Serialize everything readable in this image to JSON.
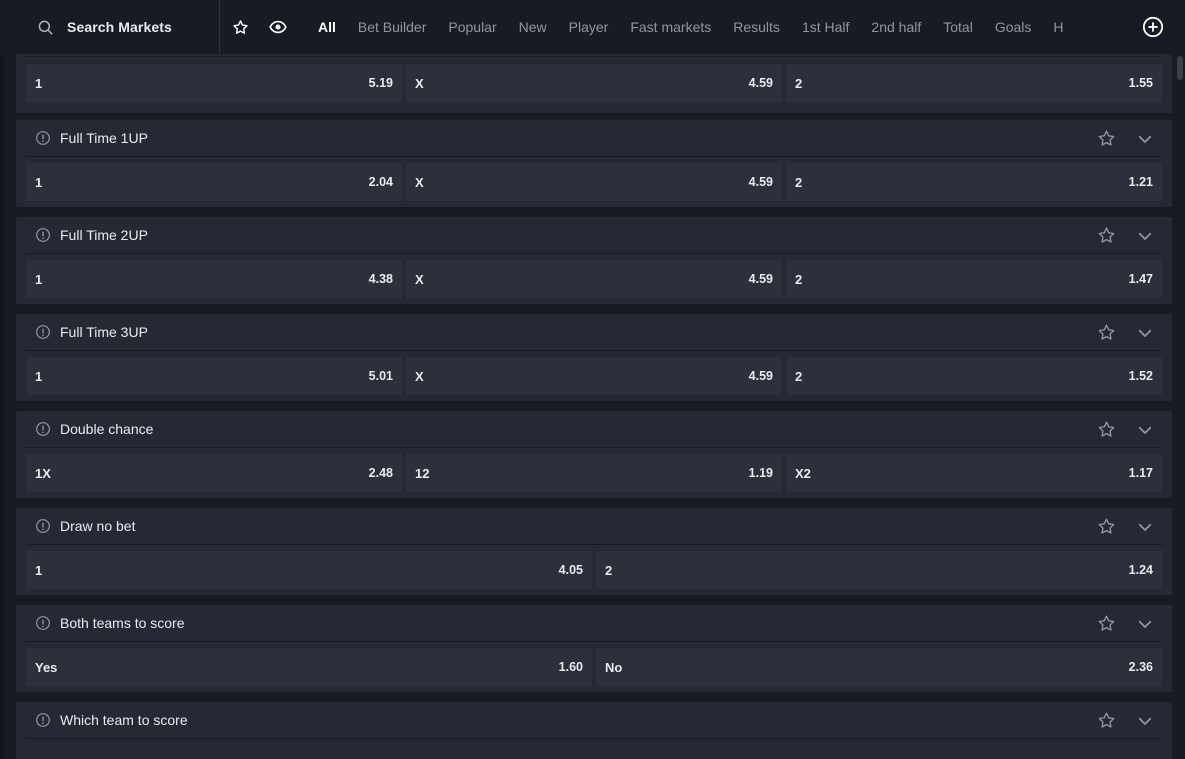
{
  "search": {
    "label": "Search Markets"
  },
  "tabs": [
    "All",
    "Bet Builder",
    "Popular",
    "New",
    "Player",
    "Fast markets",
    "Results",
    "1st Half",
    "2nd half",
    "Total",
    "Goals",
    "H"
  ],
  "active_tab": "All",
  "colors": {
    "background": "#181b22",
    "panel": "#252933",
    "odd_button": "#2b303b",
    "text": "#e9ebef",
    "muted": "#8f96a3"
  },
  "icons": {
    "search": "search-icon",
    "favourites": "star-icon",
    "watch": "eye-icon",
    "add": "plus-circle-icon",
    "info": "info-icon",
    "favourite_market": "star-outline-icon",
    "expand": "chevron-down-icon"
  },
  "top_row": [
    {
      "label": "1",
      "odd": "5.19"
    },
    {
      "label": "X",
      "odd": "4.59"
    },
    {
      "label": "2",
      "odd": "1.55"
    }
  ],
  "markets": [
    {
      "title": "Full Time 1UP",
      "outcomes": [
        {
          "label": "1",
          "odd": "2.04"
        },
        {
          "label": "X",
          "odd": "4.59"
        },
        {
          "label": "2",
          "odd": "1.21"
        }
      ]
    },
    {
      "title": "Full Time 2UP",
      "outcomes": [
        {
          "label": "1",
          "odd": "4.38"
        },
        {
          "label": "X",
          "odd": "4.59"
        },
        {
          "label": "2",
          "odd": "1.47"
        }
      ]
    },
    {
      "title": "Full Time 3UP",
      "outcomes": [
        {
          "label": "1",
          "odd": "5.01"
        },
        {
          "label": "X",
          "odd": "4.59"
        },
        {
          "label": "2",
          "odd": "1.52"
        }
      ]
    },
    {
      "title": "Double chance",
      "outcomes": [
        {
          "label": "1X",
          "odd": "2.48"
        },
        {
          "label": "12",
          "odd": "1.19"
        },
        {
          "label": "X2",
          "odd": "1.17"
        }
      ]
    },
    {
      "title": "Draw no bet",
      "outcomes": [
        {
          "label": "1",
          "odd": "4.05"
        },
        {
          "label": "2",
          "odd": "1.24"
        }
      ]
    },
    {
      "title": "Both teams to score",
      "outcomes": [
        {
          "label": "Yes",
          "odd": "1.60"
        },
        {
          "label": "No",
          "odd": "2.36"
        }
      ]
    },
    {
      "title": "Which team to score",
      "outcomes": []
    }
  ]
}
